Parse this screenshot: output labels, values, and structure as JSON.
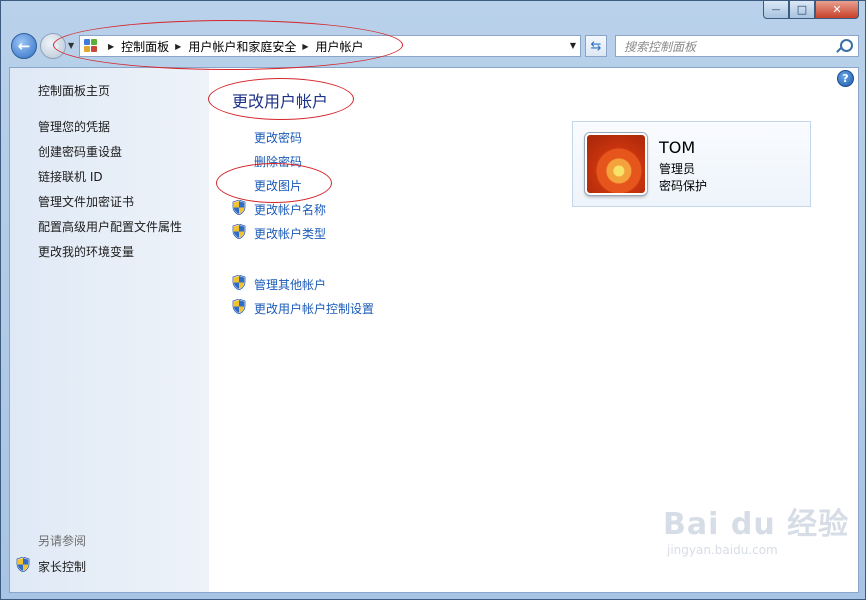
{
  "window": {
    "controls": {
      "minimize": "—",
      "maximize": "□",
      "close": "✕"
    }
  },
  "nav": {
    "back_glyph": "←",
    "forward_glyph": "→",
    "breadcrumb": [
      "控制面板",
      "用户帐户和家庭安全",
      "用户帐户"
    ],
    "search_placeholder": "搜索控制面板"
  },
  "sidebar": {
    "home": "控制面板主页",
    "items": [
      "管理您的凭据",
      "创建密码重设盘",
      "链接联机 ID",
      "管理文件加密证书",
      "配置高级用户配置文件属性",
      "更改我的环境变量"
    ],
    "see_also_heading": "另请参阅",
    "see_also_items": [
      "家长控制"
    ]
  },
  "main": {
    "title": "更改用户帐户",
    "tasks": [
      {
        "label": "更改密码",
        "shield": false
      },
      {
        "label": "删除密码",
        "shield": false
      },
      {
        "label": "更改图片",
        "shield": false
      },
      {
        "label": "更改帐户名称",
        "shield": true
      },
      {
        "label": "更改帐户类型",
        "shield": true
      }
    ],
    "other_tasks": [
      {
        "label": "管理其他帐户",
        "shield": true
      },
      {
        "label": "更改用户帐户控制设置",
        "shield": true
      }
    ],
    "help_glyph": "?"
  },
  "account": {
    "name": "TOM",
    "type": "管理员",
    "status": "密码保护"
  },
  "watermark": {
    "brand": "Bai du 经验",
    "url": "jingyan.baidu.com"
  },
  "colors": {
    "link": "#1a5bb8",
    "title": "#1e3287",
    "annotation_circle": "#d4262b"
  }
}
